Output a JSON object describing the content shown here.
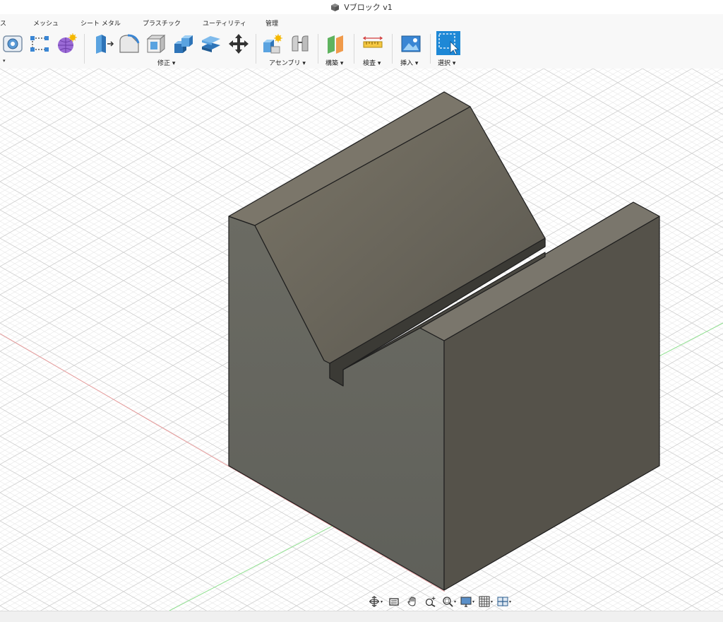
{
  "window": {
    "title": "Vブロック v1"
  },
  "ribbon": {
    "tabs": [
      {
        "id": "surface",
        "label": "ス"
      },
      {
        "id": "mesh",
        "label": "メッシュ"
      },
      {
        "id": "sheet_metal",
        "label": "シート メタル"
      },
      {
        "id": "plastic",
        "label": "プラスチック"
      },
      {
        "id": "utility",
        "label": "ユーティリティ"
      },
      {
        "id": "manage",
        "label": "管理"
      }
    ],
    "groups": {
      "modify": "修正 ▾",
      "assemble": "アセンブリ ▾",
      "construct": "構築 ▾",
      "inspect": "検査 ▾",
      "insert": "挿入 ▾",
      "select": "選択 ▾"
    },
    "left_caret": "▾"
  },
  "side_panels": {
    "browser_symbol": "−",
    "comments_symbol": "+"
  },
  "colors": {
    "accent": "#1e88d6",
    "body_face_left": "#6a6a64",
    "body_face_right": "#55524a",
    "body_top": "#7a766c",
    "axis_x": "#e07070",
    "axis_y": "#70d070"
  },
  "navbar": {
    "items": [
      {
        "icon": "orbit-icon",
        "has_caret": true
      },
      {
        "icon": "look-at-icon",
        "has_caret": false
      },
      {
        "icon": "pan-icon",
        "has_caret": false
      },
      {
        "icon": "zoom-icon",
        "has_caret": false
      },
      {
        "icon": "fit-icon",
        "has_caret": true
      },
      {
        "icon": "display-settings-icon",
        "has_caret": true
      },
      {
        "icon": "grid-icon",
        "has_caret": true
      },
      {
        "icon": "viewports-icon",
        "has_caret": true
      }
    ],
    "caret": "▾"
  }
}
